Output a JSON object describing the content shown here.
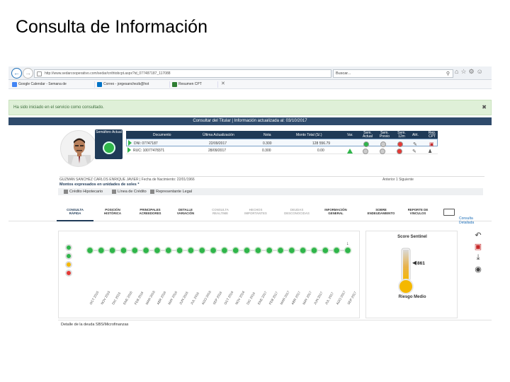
{
  "slide": {
    "title": "Consulta de Información"
  },
  "browser": {
    "url": "http://www.sedarcooperativo.com/sedar/cnthtobcpt.aspx?id_077487187_117088",
    "search_placeholder": "Buscar...",
    "favorites": [
      {
        "label": "Google Calendar - Semana de",
        "color": "#4285f4"
      },
      {
        "label": "Correo - jorgesanchezb@hot",
        "color": "#0072c6"
      },
      {
        "label": "Resumen CPT",
        "color": "#2e7d32"
      }
    ]
  },
  "notice": {
    "text": "Ha sido iniciado en el servicio como consultado."
  },
  "panel": {
    "title": "Consultar del Titular | Información actualizada al: 03/10/2017"
  },
  "semaforo": {
    "label": "Semáforo Actual"
  },
  "table": {
    "headers": [
      "Documento",
      "Última Actualización",
      "Nota",
      "Monto Total (S/.)",
      "Var.",
      "Sem. Actual",
      "Sem. Previo",
      "Sem. 12m",
      "Alrt.",
      "Rep. CPT"
    ],
    "rows": [
      {
        "doc": "DNI: 07747187",
        "date": "22/09/2017",
        "nota": "0.300",
        "monto": "128 556.79"
      },
      {
        "doc": "RUC: 10077478371",
        "date": "28/09/2017",
        "nota": "0.300",
        "monto": "0.00"
      }
    ]
  },
  "person": {
    "name_line": "GUZMAN SANCHEZ CARLOS ENRIQUE JAVIER | Fecha de Nacimiento: 22/01/1966",
    "pagination": "Anterior 1 Siguiente",
    "montos_note": "Montos expresados en unidades de soles *",
    "links": [
      "Crédito Hipotecario",
      "Línea de Crédito",
      "Representante Legal"
    ]
  },
  "tabs": [
    {
      "label": "CONSULTA\nRÁPIDA",
      "state": "active"
    },
    {
      "label": "POSICIÓN\nHISTÓRICA",
      "state": "normal"
    },
    {
      "label": "PRINCIPALES\nACREEDORES",
      "state": "normal"
    },
    {
      "label": "DETALLE\nVARIACIÓN",
      "state": "normal"
    },
    {
      "label": "CONSULTA\nREALTIME",
      "state": "dim"
    },
    {
      "label": "HECHOS\nIMPORTANTES",
      "state": "dim"
    },
    {
      "label": "DEUDAS\nDESCONOCIDAS",
      "state": "dim"
    },
    {
      "label": "INFORMACIÓN\nGENERAL",
      "state": "normal"
    },
    {
      "label": "SOBRE\nENDEUDAMIENTO",
      "state": "normal"
    },
    {
      "label": "REPORTE DE\nVINCULOS",
      "state": "normal"
    }
  ],
  "detail_link": "Consulta\nDetallada",
  "chart_data": {
    "type": "scatter",
    "x": [
      "OCT 2015",
      "NOV 2015",
      "DIC 2015",
      "ENE 2016",
      "FEB 2016",
      "MAR 2016",
      "ABR 2016",
      "MAY 2016",
      "JUN 2016",
      "JUL 2016",
      "AGO 2016",
      "SEP 2016",
      "OCT 2016",
      "NOV 2016",
      "DIC 2016",
      "ENE 2017",
      "FEB 2017",
      "MAR 2017",
      "ABR 2017",
      "MAY 2017",
      "JUN 2017",
      "JUL 2017",
      "AGO 2017",
      "SEP 2017"
    ],
    "series": [
      {
        "values": [
          "verde",
          "verde",
          "verde",
          "verde",
          "verde",
          "verde",
          "verde",
          "verde",
          "verde",
          "verde",
          "verde",
          "verde",
          "verde",
          "verde",
          "verde",
          "verde",
          "verde",
          "verde",
          "verde",
          "verde",
          "verde",
          "verde",
          "verde",
          "verde"
        ]
      }
    ],
    "legend_levels": [
      "verde",
      "verde",
      "amarillo",
      "rojo"
    ],
    "legend_colors": [
      "#2fb54a",
      "#2fb54a",
      "#f5b800",
      "#e53935"
    ]
  },
  "score": {
    "title": "Score Sentinel",
    "value": "861",
    "risk_label": "Riesgo Medio",
    "fill_fraction": 0.55,
    "color": "#f5b800"
  },
  "detail_footer": "Detalle de la deuda SBS/Microfinanzas"
}
